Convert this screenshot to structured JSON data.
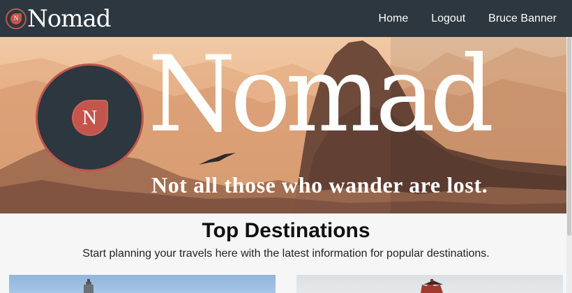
{
  "navbar": {
    "brand": "Nomad",
    "logo_letter": "N",
    "links": [
      {
        "label": "Home"
      },
      {
        "label": "Logout"
      },
      {
        "label": "Bruce Banner"
      }
    ]
  },
  "hero": {
    "logo_letter": "N",
    "title": "Nomad",
    "tagline": "Not all those who wander are lost."
  },
  "destinations": {
    "title": "Top Destinations",
    "subtitle": "Start planning your travels here with the latest information for popular destinations."
  },
  "colors": {
    "navbar_bg": "#2c3740",
    "accent": "#c4554d",
    "page_bg": "#f6f6f6"
  },
  "icons": [
    "nomad-logo-icon",
    "nomad-hero-logo-icon"
  ]
}
